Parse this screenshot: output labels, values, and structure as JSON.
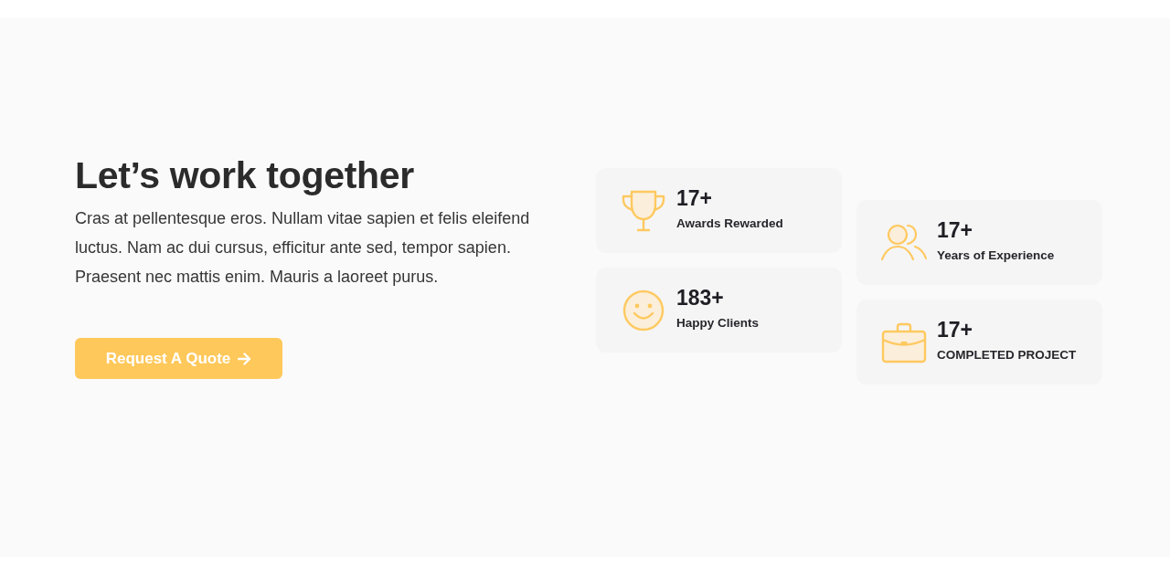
{
  "intro": {
    "heading": "Let’s work together",
    "body": "Cras at pellentesque eros. Nullam vitae sapien et felis eleifend luctus. Nam ac dui cursus, efficitur ante sed, tempor sapien. Praesent nec mattis enim. Mauris a laoreet purus.",
    "button": {
      "label": "Request A Quote"
    }
  },
  "stat_columns": [
    {
      "stats": [
        {
          "value": "17+",
          "label": "Awards Rewarded"
        },
        {
          "value": "183+",
          "label": "Happy Clients"
        }
      ]
    },
    {
      "stats": [
        {
          "value": "17+",
          "label": "Years of Experience"
        },
        {
          "value": "17+",
          "label": "COMPLETED PROJECT"
        }
      ]
    }
  ]
}
